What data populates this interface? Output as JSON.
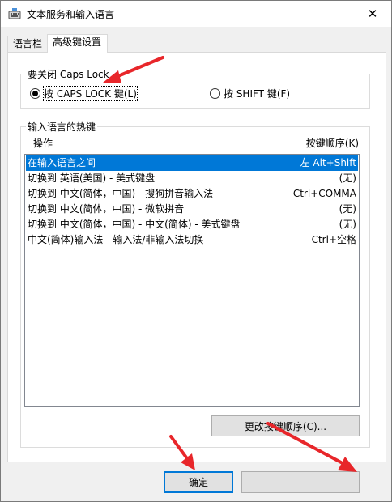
{
  "window": {
    "title": "文本服务和输入语言",
    "close_glyph": "✕"
  },
  "tabs": [
    {
      "label": "语言栏",
      "active": false
    },
    {
      "label": "高级键设置",
      "active": true
    }
  ],
  "caps_group": {
    "label": "要关闭 Caps Lock",
    "options": [
      {
        "label": "按 CAPS LOCK 键(L)",
        "checked": true
      },
      {
        "label": "按 SHIFT 键(F)",
        "checked": false
      }
    ]
  },
  "hotkey_group": {
    "label": "输入语言的热键",
    "col_action": "操作",
    "col_sequence": "按键顺序(K)",
    "rows": [
      {
        "action": "在输入语言之间",
        "hotkey": "左 Alt+Shift",
        "selected": true
      },
      {
        "action": "切换到 英语(美国) - 美式键盘",
        "hotkey": "(无)",
        "selected": false
      },
      {
        "action": "切换到 中文(简体，中国) - 搜狗拼音输入法",
        "hotkey": "Ctrl+COMMA",
        "selected": false
      },
      {
        "action": "切换到 中文(简体，中国) - 微软拼音",
        "hotkey": "(无)",
        "selected": false
      },
      {
        "action": "切换到 中文(简体，中国) - 中文(简体) - 美式键盘",
        "hotkey": "(无)",
        "selected": false
      },
      {
        "action": "中文(简体)输入法 - 输入法/非输入法切换",
        "hotkey": "Ctrl+空格",
        "selected": false
      }
    ],
    "change_button": "更改按键顺序(C)..."
  },
  "footer": {
    "ok_label": "确定",
    "second_label": ""
  },
  "colors": {
    "selection": "#0078d7",
    "annotation_arrow": "#e8262a"
  }
}
